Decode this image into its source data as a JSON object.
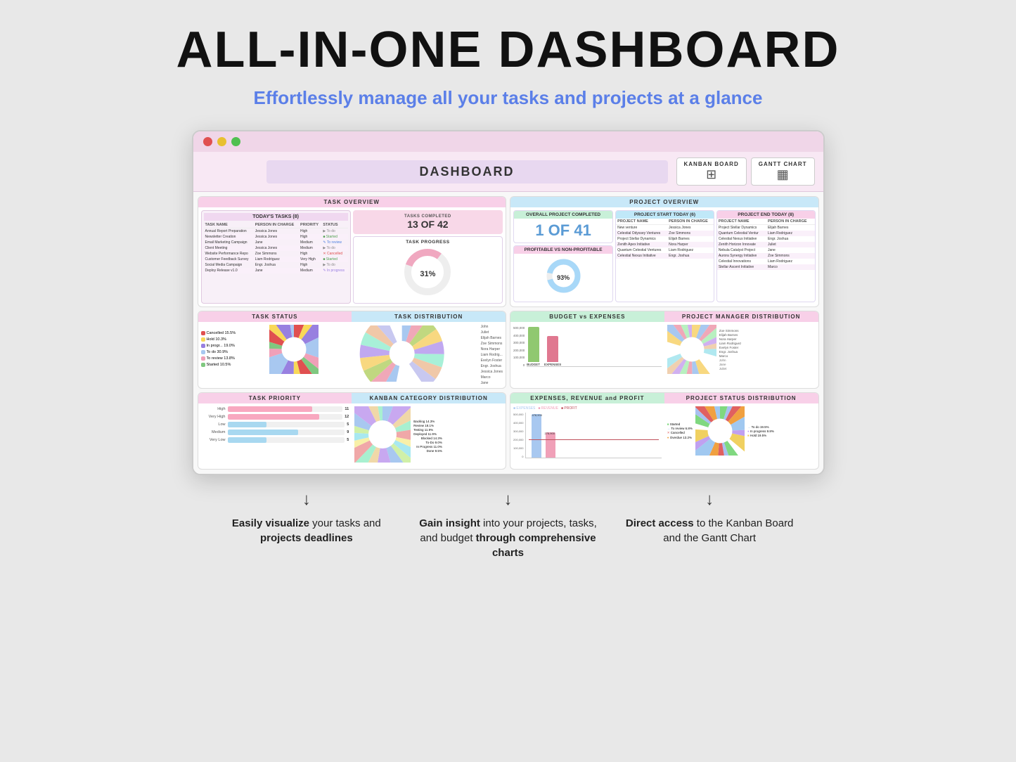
{
  "page": {
    "main_title": "ALL-IN-ONE DASHBOARD",
    "subtitle": "Effortlessly manage all your tasks and projects at a glance"
  },
  "dashboard": {
    "title": "DASHBOARD",
    "kanban_btn": "KANBAN BOARD",
    "gantt_btn": "GANTT CHART"
  },
  "task_overview": {
    "header": "TASK OVERVIEW",
    "today_tasks": {
      "title": "TODAY'S TASKS (8)",
      "columns": [
        "TASK NAME",
        "PERSON IN CHARGE",
        "PRIORITY",
        "STATUS"
      ],
      "rows": [
        [
          "Annual Report Preparation",
          "Jessica Jones",
          "High",
          "To do"
        ],
        [
          "Newsletter Creation",
          "Jessica Jones",
          "High",
          "Started"
        ],
        [
          "Email Marketing Campaign",
          "Jane",
          "Medium",
          "To review"
        ],
        [
          "Client Meeting",
          "Jessica Jones",
          "Medium",
          "To do"
        ],
        [
          "Website Performance Repo",
          "Zoe Simmons",
          "High",
          "Cancelled"
        ],
        [
          "Customer Feedback Survey",
          "Liam Rodriguez",
          "Very High",
          "Started"
        ],
        [
          "Social Media Campaign",
          "Engr. Joshua",
          "High",
          "To do"
        ],
        [
          "Deploy Release v1.0",
          "Jane",
          "Medium",
          "In progress"
        ]
      ]
    },
    "tasks_completed": {
      "number": "13 OF 42",
      "label": "TASKS COMPLETED"
    },
    "task_progress": {
      "title": "TASK PROGRESS",
      "percent": "31%"
    }
  },
  "project_overview": {
    "header": "PROJECT OVERVIEW",
    "overall_completed": {
      "label": "OVERALL PROJECT COMPLETED",
      "value": "1 OF 41"
    },
    "project_start_today": {
      "label": "PROJECT START TODAY (6)",
      "rows": [
        [
          "New venture",
          "Jessica Jones"
        ],
        [
          "Celestial Odyssey Ventures",
          "Zoe Simmons"
        ],
        [
          "Project Stellar Dynamics",
          "Elijah Barnes"
        ],
        [
          "Zenith Apex Initiative",
          "Nora Harper"
        ],
        [
          "Quantum Celestial Ventures",
          "Liam Rodriguez"
        ],
        [
          "Celestial Nexus Initiative",
          "Engr. Joshua"
        ]
      ]
    },
    "project_end_today": {
      "label": "PROJECT END TODAY (8)",
      "rows": [
        [
          "Project Stellar Dynamics",
          "Elijah Barnes"
        ],
        [
          "Quantum Celestial Ventur",
          "Liam Rodriguez"
        ],
        [
          "Celestial Nexus Initiative",
          "Engr. Joshua"
        ],
        [
          "Zenith Horizon Innovate",
          "Juliet"
        ],
        [
          "Nebula Catalyst Project",
          "Jane"
        ],
        [
          "Aurora Synergy Initiative",
          "Zoe Simmons"
        ],
        [
          "Celestial Innovations",
          "Liam Rodriguez"
        ],
        [
          "Stellar Ascent Initiative",
          "Marco"
        ]
      ]
    },
    "profitable": {
      "label": "PROFITABLE VS NON-PROFITABLE",
      "percent": "93%"
    }
  },
  "task_status": {
    "header": "TASK STATUS",
    "legend": [
      {
        "label": "Cancelled",
        "color": "#e05050"
      },
      {
        "label": "Hold",
        "color": "#f8d858"
      },
      {
        "label": "In progr...",
        "color": "#9880e0"
      },
      {
        "label": "To do",
        "color": "#a8c8f0"
      },
      {
        "label": "To review",
        "color": "#f0a0b8"
      },
      {
        "label": "Started",
        "color": "#80c880"
      }
    ],
    "percentages": [
      "15.5%",
      "10.3%",
      "19.0%",
      "30.9%",
      "13.8%",
      "10.5%"
    ]
  },
  "task_distribution": {
    "header": "TASK DISTRIBUTION",
    "people": [
      {
        "name": "Zoe Simmons",
        "pct": 9.5
      },
      {
        "name": "Nora Harper",
        "pct": 9.5
      },
      {
        "name": "Liam Rodrig...",
        "pct": 9.5
      },
      {
        "name": "Evelyn Foster",
        "pct": 9.5
      },
      {
        "name": "Engr. Joshua",
        "pct": 9.5
      },
      {
        "name": "Marco",
        "pct": 9.5
      }
    ],
    "right_labels": [
      "John",
      "Juliet",
      "Elijah Barnes",
      "Jessica Jones",
      "Jane"
    ]
  },
  "task_priority": {
    "header": "TASK PRIORITY",
    "bars": [
      {
        "label": "High",
        "value": 11,
        "max": 15,
        "color": "#f8a8c0"
      },
      {
        "label": "Very High",
        "value": 12,
        "max": 15,
        "color": "#f8a8c0"
      },
      {
        "label": "Low",
        "value": 5,
        "max": 15,
        "color": "#a8d8f0"
      },
      {
        "label": "Medium",
        "value": 9,
        "max": 15,
        "color": "#a8d8f0"
      },
      {
        "label": "Very Low",
        "value": 5,
        "max": 15,
        "color": "#a8d8f0"
      }
    ]
  },
  "kanban_distribution": {
    "header": "KANBAN CATEGORY DISTRIBUTION",
    "categories": [
      {
        "label": "Backlog",
        "pct": "14.3%",
        "color": "#a8c8f0"
      },
      {
        "label": "Review",
        "pct": "18.1%",
        "color": "#c8a8f0"
      },
      {
        "label": "Testing",
        "pct": "11.9%",
        "color": "#f0d8a8"
      },
      {
        "label": "Deployed",
        "pct": "11.9%",
        "color": "#a8f0d0"
      },
      {
        "label": "Blocked",
        "pct": "14.3%",
        "color": "#f0a8a8"
      },
      {
        "label": "To-Do",
        "pct": "9.0%",
        "color": "#f8f0a8"
      },
      {
        "label": "In Progress",
        "pct": "11.0%",
        "color": "#a8e8f0"
      },
      {
        "label": "Done",
        "pct": "9.5%",
        "color": "#d0f0a8"
      }
    ]
  },
  "budget_expenses": {
    "header": "BUDGET vs EXPENSES",
    "y_labels": [
      "500,000",
      "400,000",
      "300,000",
      "200,000",
      "100,000",
      "0"
    ],
    "bars": [
      {
        "label": "BUDGET",
        "value": 420000,
        "max": 500000,
        "color": "#90c870"
      },
      {
        "label": "EXPENSES",
        "value": 310000,
        "max": 500000,
        "color": "#e07890"
      }
    ]
  },
  "project_manager_dist": {
    "header": "PROJECT MANAGER DISTRIBUTION",
    "people": [
      {
        "name": "Zoe Simmons",
        "pct": 14.0,
        "color": "#f8d880"
      },
      {
        "name": "Elijah Barnes",
        "pct": 11.0,
        "color": "#a8c8f0"
      },
      {
        "name": "Nora Harper",
        "pct": 9.0,
        "color": "#f0a8b8"
      },
      {
        "name": "Liam Rodriguez",
        "pct": 10.0,
        "color": "#b8f0c0"
      },
      {
        "name": "Evelyn Foster",
        "pct": 9.0,
        "color": "#d0b0f0"
      },
      {
        "name": "Engr. Joshua",
        "pct": 9.0,
        "color": "#f0d0b0"
      },
      {
        "name": "Marco",
        "pct": 12.0,
        "color": "#b0e8f0"
      }
    ],
    "right_labels": [
      "John",
      "Jane",
      "Juliet"
    ]
  },
  "expenses_revenue_profit": {
    "header": "EXPENSES, REVENUE and PROFIT",
    "legend": [
      "EXPENSES",
      "REVENUE",
      "PROFIT"
    ],
    "y_labels": [
      "500,000",
      "400,000",
      "300,000",
      "200,000",
      "100,000",
      "0"
    ],
    "values": {
      "bar1": 478900,
      "bar2": 278900
    }
  },
  "project_status_dist": {
    "header": "PROJECT STATUS DISTRIBUTION",
    "legend": [
      {
        "label": "Started",
        "color": "#80d880"
      },
      {
        "label": "To review",
        "color": "#a8c0f0"
      },
      {
        "label": "Cancelled",
        "color": "#e06060"
      },
      {
        "label": "Overdue",
        "color": "#f0a040"
      },
      {
        "label": "To do",
        "color": "#a0c8f0"
      },
      {
        "label": "In progress",
        "color": "#c0a0f0"
      },
      {
        "label": "Hold",
        "color": "#f0d060"
      }
    ],
    "percentages": {
      "to_do": "19.5%",
      "to_review": "6.8%",
      "in_progress": "9.8%",
      "cancelled": "9.8%",
      "overdue": "13.2%",
      "hold": "19.5%"
    }
  },
  "annotations": {
    "left": {
      "arrow": "↓",
      "text_bold": "Easily visualize",
      "text_normal": " your tasks and ",
      "text2_bold": "projects deadlines",
      "text2_normal": ""
    },
    "center": {
      "arrow": "↓",
      "text_bold": "Gain insight",
      "text_normal": " into your projects, tasks, and budget ",
      "text2_bold": "through comprehensive charts",
      "text2_normal": ""
    },
    "right": {
      "arrow": "↓",
      "text_bold": "Direct access",
      "text_normal": " to the Kanban Board and the Gantt Chart",
      "text2": ""
    }
  }
}
